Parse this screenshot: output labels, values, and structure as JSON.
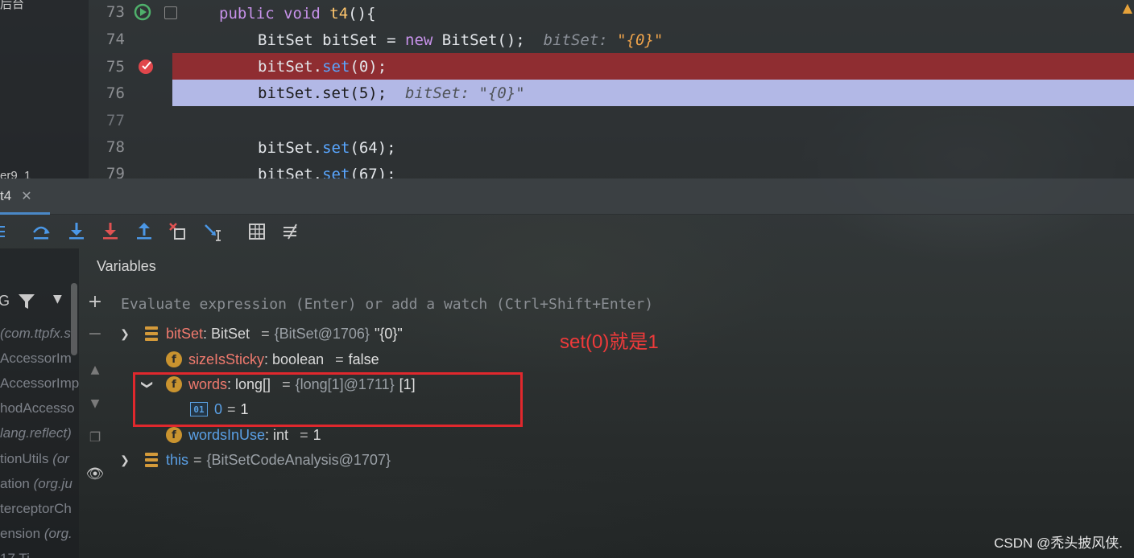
{
  "editor": {
    "left_fragments": [
      "后台",
      "er9_1"
    ],
    "warning_icon": "warning-icon",
    "lines": [
      {
        "num": "73",
        "code_parts": [
          [
            "kwb",
            "public "
          ],
          [
            "kwb",
            "void "
          ],
          [
            "fn",
            "t4"
          ],
          [
            "",
            "(){"
          ]
        ]
      },
      {
        "num": "74",
        "code_parts": [
          [
            "",
            "BitSet bitSet = "
          ],
          [
            "kwb",
            "new "
          ],
          [
            "",
            "BitSet();"
          ]
        ],
        "inline_hint": "bitSet: ",
        "inline_value": "\"{0}\""
      },
      {
        "num": "75",
        "code_parts": [
          [
            "",
            "bitSet."
          ],
          [
            "call",
            "set"
          ],
          [
            "",
            "(0);"
          ]
        ]
      },
      {
        "num": "76",
        "code_parts": [
          [
            "",
            "bitSet.set(5);"
          ]
        ],
        "inline_hint": "bitSet: ",
        "inline_value": "\"{0}\""
      },
      {
        "num": "77",
        "code_parts": []
      },
      {
        "num": "78",
        "code_parts": [
          [
            "",
            "bitSet."
          ],
          [
            "call",
            "set"
          ],
          [
            "",
            "(64);"
          ]
        ]
      },
      {
        "num": "79",
        "code_parts": [
          [
            "",
            "bitSet."
          ],
          [
            "call",
            "set"
          ],
          [
            "",
            "(67);"
          ]
        ]
      }
    ]
  },
  "tabs": {
    "active": "t4",
    "close_icon": "close-icon"
  },
  "toolbar": {
    "icons": [
      "menu-icon",
      "step-over-icon",
      "step-into-icon",
      "force-step-into-icon",
      "step-out-icon",
      "drop-frame-icon",
      "run-to-cursor-icon",
      "evaluate-expression-icon",
      "trace-icon"
    ]
  },
  "variables": {
    "title": "Variables",
    "watch_placeholder": "Evaluate expression (Enter) or add a watch (Ctrl+Shift+Enter)",
    "tree": {
      "bitset": {
        "name": "bitSet",
        "type": ": BitSet",
        "eq": "=",
        "ref": "{BitSet@1706}",
        "value": "\"{0}\""
      },
      "sizeIsSticky": {
        "badge": "f",
        "name": "sizeIsSticky",
        "type": ": boolean",
        "eq": "=",
        "value": "false"
      },
      "words": {
        "badge": "f",
        "name": "words",
        "type": ": long[]",
        "eq": "=",
        "ref": "{long[1]@1711}",
        "value": "[1]"
      },
      "words0": {
        "badge": "01",
        "name": "0",
        "eq": "=",
        "value": "1"
      },
      "wordsInUse": {
        "badge": "f",
        "name": "wordsInUse",
        "type": ": int",
        "eq": "=",
        "value": "1"
      },
      "this": {
        "name": "this",
        "eq": "=",
        "ref": "{BitSetCodeAnalysis@1707}"
      }
    }
  },
  "frames": {
    "filter_letter": "G",
    "items": [
      {
        "main": "",
        "pkg": "(com.ttpfx.s"
      },
      {
        "main": "AccessorIm",
        "pkg": ""
      },
      {
        "main": "AccessorImp",
        "pkg": ""
      },
      {
        "main": "hodAccesso",
        "pkg": ""
      },
      {
        "main": "",
        "pkg": "lang.reflect)"
      },
      {
        "main": "tionUtils ",
        "pkg": "(or"
      },
      {
        "main": "ation ",
        "pkg": "(org.ju"
      },
      {
        "main": "terceptorCh",
        "pkg": ""
      },
      {
        "main": "ension ",
        "pkg": "(org."
      },
      {
        "main": "17 Ti",
        "pkg": ""
      }
    ]
  },
  "annotation": "set(0)就是1",
  "watermark": "CSDN @秃头披风侠."
}
